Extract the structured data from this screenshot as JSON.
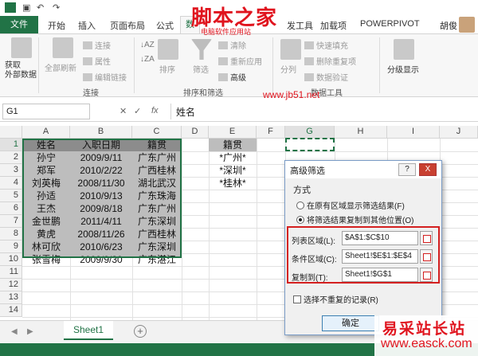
{
  "titlebar": {
    "save_icon": "save-icon",
    "undo_icon": "undo-icon",
    "redo_icon": "redo-icon"
  },
  "ribbon_tabs": [
    {
      "label": "文件"
    },
    {
      "label": "开始"
    },
    {
      "label": "插入"
    },
    {
      "label": "页面布局"
    },
    {
      "label": "公式"
    },
    {
      "label": "数"
    },
    {
      "label": "发工具"
    },
    {
      "label": "加载项"
    },
    {
      "label": "POWERPIVOT"
    }
  ],
  "user": {
    "name": "胡俊"
  },
  "ribbon": {
    "get_external": "获取\n外部数据",
    "refresh_all": "全部刷新",
    "connections": "连接",
    "properties": "属性",
    "edit_links": "编辑链接",
    "sort": "排序",
    "filter": "筛选",
    "clear": "清除",
    "reapply": "重新应用",
    "advanced": "高级",
    "split": "分列",
    "flash_fill": "快速填充",
    "remove_dup": "删除重复项",
    "validation": "数据验证",
    "outline": "分级显示",
    "group_connections": "连接",
    "group_sort_filter": "排序和筛选",
    "group_data_tools": "数据工具"
  },
  "formula_bar": {
    "name_box": "G1",
    "fx": "fx",
    "value": "姓名"
  },
  "columns": [
    "A",
    "B",
    "C",
    "D",
    "E",
    "F",
    "G",
    "H",
    "I",
    "J"
  ],
  "rows": [
    "1",
    "2",
    "3",
    "4",
    "5",
    "6",
    "7",
    "8",
    "9",
    "10",
    "11",
    "12",
    "13",
    "14"
  ],
  "table": {
    "headers": [
      "姓名",
      "入职日期",
      "籍贯"
    ],
    "rows": [
      [
        "孙宁",
        "2009/9/11",
        "广东广州"
      ],
      [
        "郑军",
        "2010/2/22",
        "广西桂林"
      ],
      [
        "刘英梅",
        "2008/11/30",
        "湖北武汉"
      ],
      [
        "孙适",
        "2010/9/13",
        "广东珠海"
      ],
      [
        "王杰",
        "2009/8/18",
        "广东广州"
      ],
      [
        "金世鹏",
        "2011/4/11",
        "广东深圳"
      ],
      [
        "黄虎",
        "2008/11/26",
        "广西桂林"
      ],
      [
        "林可欣",
        "2010/6/23",
        "广东深圳"
      ],
      [
        "张雪梅",
        "2009/9/30",
        "广东湛江"
      ]
    ]
  },
  "criteria": {
    "header": "籍贯",
    "values": [
      "*广州*",
      "*深圳*",
      "*桂林*"
    ]
  },
  "sheet": {
    "tab": "Sheet1",
    "add": "+"
  },
  "dialog": {
    "title": "高级筛选",
    "help": "?",
    "close": "X",
    "section": "方式",
    "radio1": "在原有区域显示筛选结果(F)",
    "radio2": "将筛选结果复制到其他位置(O)",
    "list_range_label": "列表区域(L):",
    "list_range_value": "$A$1:$C$10",
    "criteria_label": "条件区域(C):",
    "criteria_value": "Sheet1!$E$1:$E$4",
    "copy_to_label": "复制到(T):",
    "copy_to_value": "Sheet1!$G$1",
    "unique_label": "选择不重复的记录(R)",
    "ok": "确定"
  },
  "watermarks": {
    "top": "脚本之家",
    "top_sub": "电脑软件应用站",
    "web": "www.jb51.net",
    "bottom": "易采站长站",
    "bottom_url": "www.easck.com"
  },
  "colors": {
    "excel_green": "#217346",
    "highlight_red": "#d42020"
  }
}
